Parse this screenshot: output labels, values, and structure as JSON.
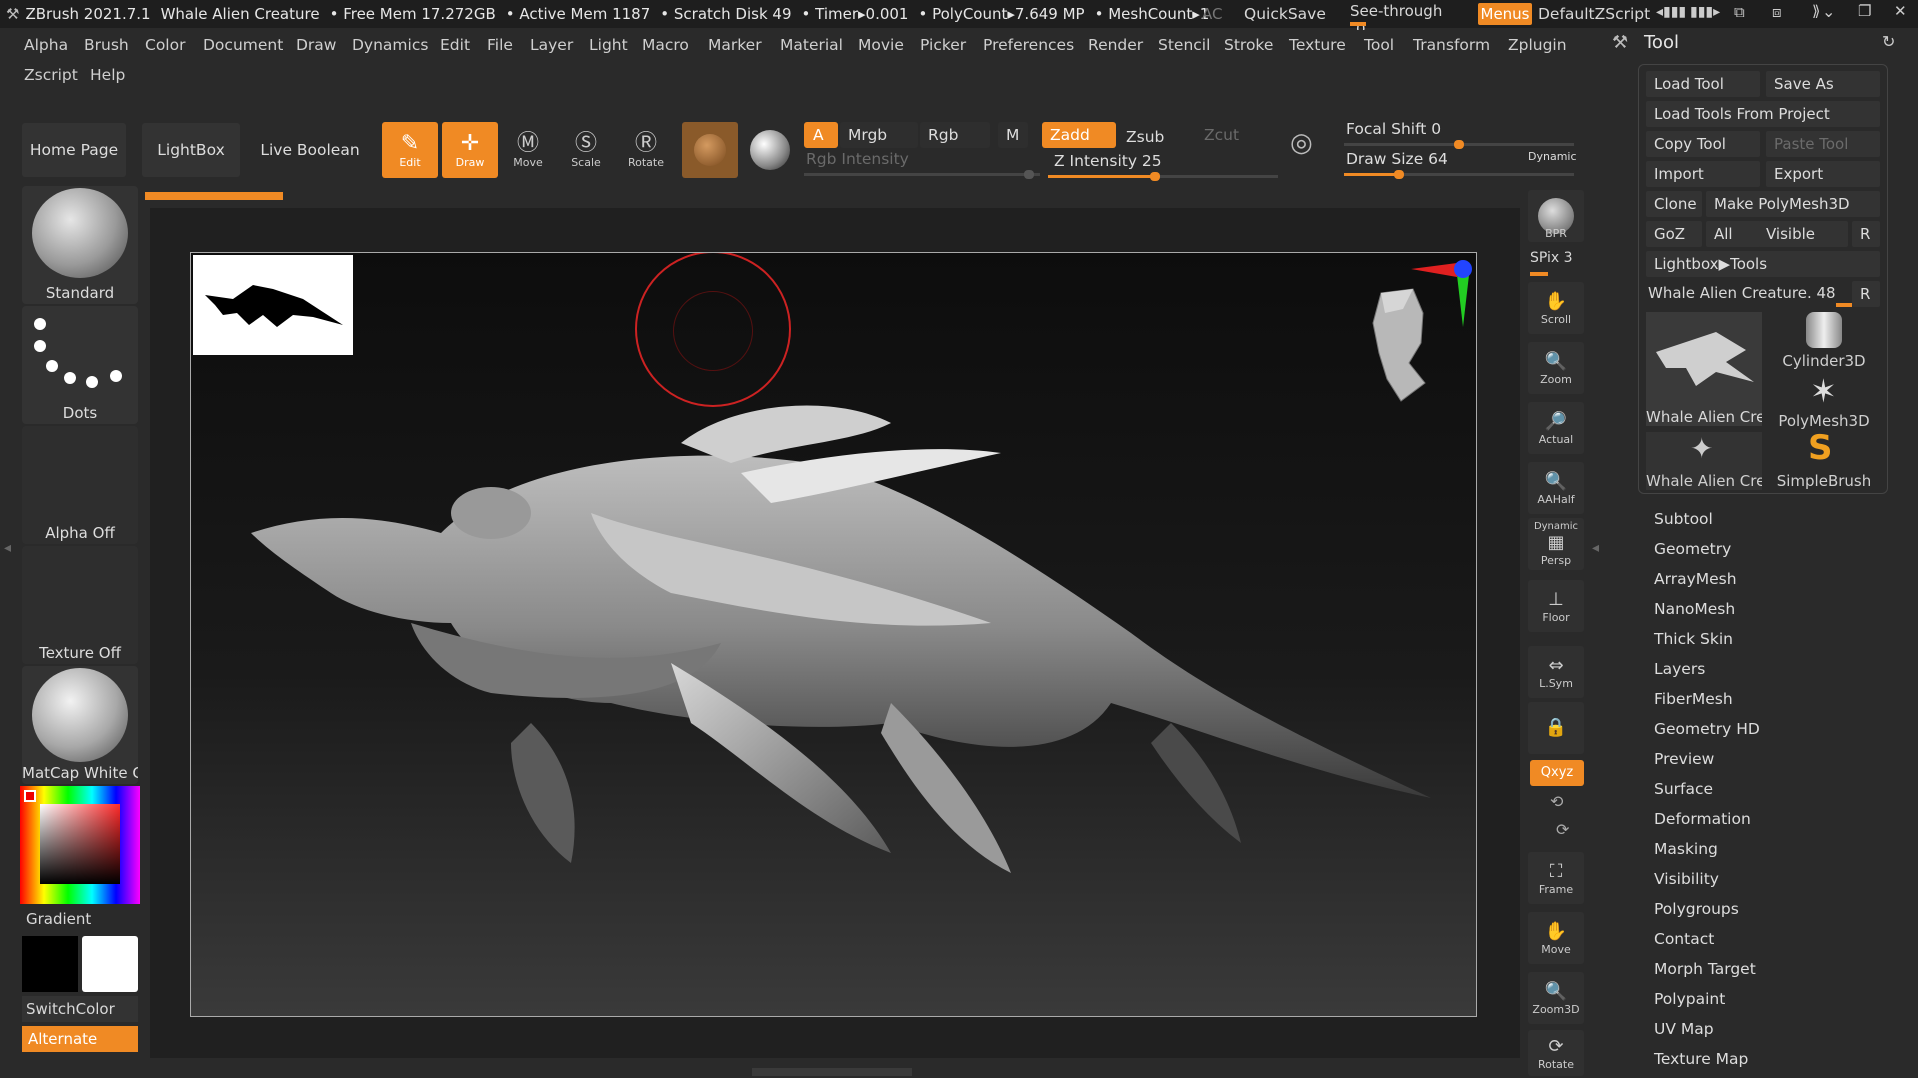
{
  "titlebar": {
    "app": "ZBrush 2021.7.1",
    "document": "Whale Alien Creature",
    "free_mem": "• Free Mem 17.272GB",
    "active_mem": "• Active Mem 1187",
    "scratch": "• Scratch Disk 49",
    "timer": "• Timer▸0.001",
    "polycount": "• PolyCount▸7.649 MP",
    "meshcount": "• MeshCount▸1",
    "ac": "AC",
    "quicksave": "QuickSave",
    "seethrough_label": "See-through",
    "seethrough_value": "0",
    "menus": "Menus",
    "script": "DefaultZScript"
  },
  "menus": [
    "Alpha",
    "Brush",
    "Color",
    "Document",
    "Draw",
    "Dynamics",
    "Edit",
    "File",
    "Layer",
    "Light",
    "Macro",
    "Marker",
    "Material",
    "Movie",
    "Picker",
    "Preferences",
    "Render",
    "Stencil",
    "Stroke",
    "Texture",
    "Tool",
    "Transform",
    "Zplugin",
    "Zscript",
    "Help"
  ],
  "shelf": {
    "home": "Home Page",
    "lightbox": "LightBox",
    "live_boolean": "Live Boolean",
    "edit": "Edit",
    "draw": "Draw",
    "move": "Move",
    "scale": "Scale",
    "rotate": "Rotate",
    "a": "A",
    "mrgb": "Mrgb",
    "rgb": "Rgb",
    "m": "M",
    "zadd": "Zadd",
    "zsub": "Zsub",
    "zcut": "Zcut",
    "rgb_intensity": "Rgb Intensity",
    "z_intensity": "Z Intensity 25",
    "focal_shift": "Focal Shift 0",
    "draw_size": "Draw Size 64",
    "dynamic": "Dynamic",
    "z_intensity_value": 25,
    "draw_size_value": 64
  },
  "left": {
    "brush": "Standard",
    "stroke": "Dots",
    "alpha": "Alpha Off",
    "texture": "Texture Off",
    "material": "MatCap White C",
    "gradient": "Gradient",
    "switchcolor": "SwitchColor",
    "alternate": "Alternate"
  },
  "right_strip": {
    "bpr": "BPR",
    "spix": "SPix 3",
    "scroll": "Scroll",
    "zoom": "Zoom",
    "actual": "Actual",
    "aahalf": "AAHalf",
    "dynamic": "Dynamic",
    "persp": "Persp",
    "floor": "Floor",
    "lsym": "L.Sym",
    "xyz": "Qxyz",
    "frame": "Frame",
    "move": "Move",
    "zoom3d": "Zoom3D",
    "rotate": "Rotate"
  },
  "tool": {
    "title": "Tool",
    "load_tool": "Load Tool",
    "save_as": "Save As",
    "load_project": "Load Tools From Project",
    "copy_tool": "Copy Tool",
    "paste_tool": "Paste Tool",
    "import": "Import",
    "export": "Export",
    "clone": "Clone",
    "make_polymesh": "Make PolyMesh3D",
    "goz": "GoZ",
    "all": "All",
    "visible": "Visible",
    "r": "R",
    "lightbox_tools": "Lightbox▶Tools",
    "current": "Whale Alien Creature. 48",
    "thumbs": [
      "Whale Alien Crea",
      "Cylinder3D",
      "PolyMesh3D",
      "Whale Alien Crea",
      "SimpleBrush"
    ],
    "subpalettes": [
      "Subtool",
      "Geometry",
      "ArrayMesh",
      "NanoMesh",
      "Thick Skin",
      "Layers",
      "FiberMesh",
      "Geometry HD",
      "Preview",
      "Surface",
      "Deformation",
      "Masking",
      "Visibility",
      "Polygroups",
      "Contact",
      "Morph Target",
      "Polypaint",
      "UV Map",
      "Texture Map"
    ]
  },
  "colors": {
    "accent": "#f08a24",
    "bg": "#2a2a2a",
    "panel": "#333333"
  }
}
